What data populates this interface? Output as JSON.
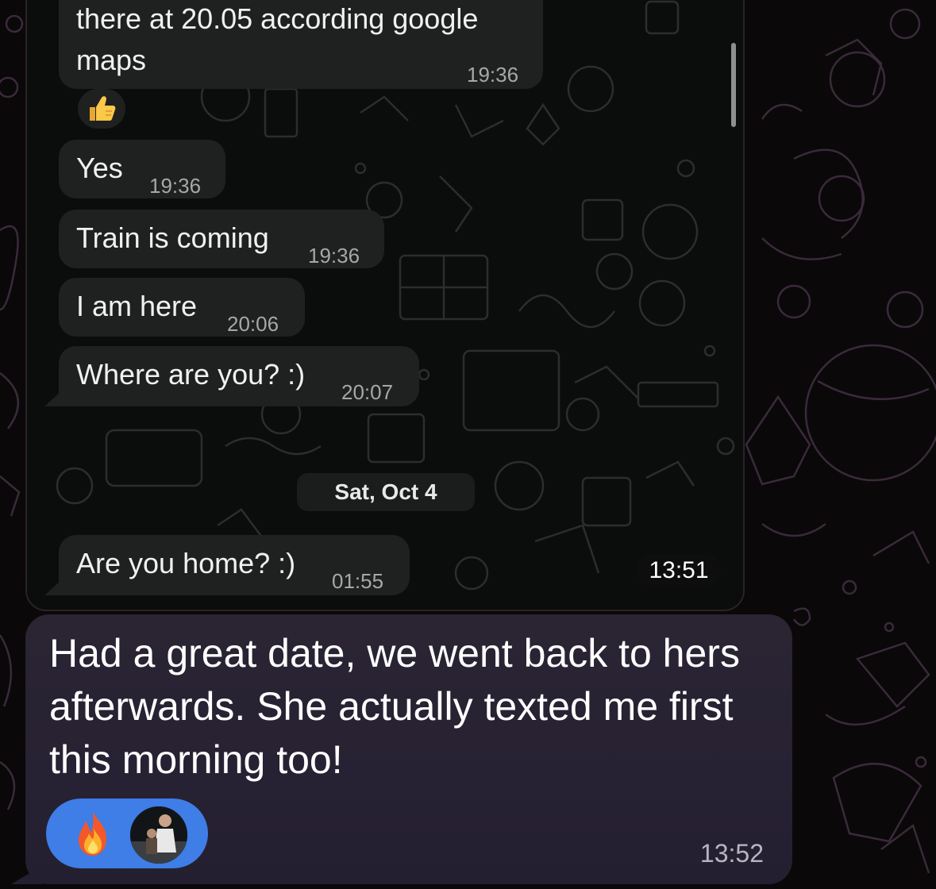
{
  "outer_chat": {
    "message": {
      "lines": [
        "Had a great date, we went back to hers",
        "afterwards. She actually texted me first",
        "this morning too!"
      ],
      "time": "13:52",
      "reactions": [
        "fire-emoji",
        "avatar"
      ]
    }
  },
  "screenshot": {
    "status_time": "13:51",
    "messages": [
      {
        "lines": [
          "there at 20.05 according google",
          "maps"
        ],
        "time": "19:36"
      },
      {
        "text": "Yes",
        "time": "19:36"
      },
      {
        "text": "Train is coming",
        "time": "19:36"
      },
      {
        "text": "I am here",
        "time": "20:06"
      },
      {
        "text": "Where are you? :)",
        "time": "20:07"
      },
      {
        "text": "Are you home? :)",
        "time": "01:55"
      }
    ],
    "reaction": "thumbs-up-emoji",
    "date_separator": "Sat, Oct 4"
  },
  "colors": {
    "background": "#0a0809",
    "incoming_bubble": "#1f2121",
    "outgoing_bubble": "#2a2433",
    "reaction_pill": "#3f7de7"
  }
}
